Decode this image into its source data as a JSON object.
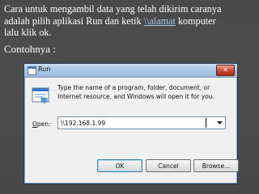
{
  "slide": {
    "line1": "Cara untuk mengambil data yang telah dikirim caranya",
    "line2_before": "adalah pilih aplikasi Run dan ketik ",
    "link": "\\\\alamat",
    "line2_after": " komputer",
    "line3": "lalu klik ok.",
    "example_label": "Contohnya :"
  },
  "dialog": {
    "title": "Run",
    "close_glyph": "✕",
    "description": "Type the name of a program, folder, document, or Internet resource, and Windows will open it for you.",
    "open_label_underlined": "O",
    "open_label_rest": "pen:",
    "open_value": "\\\\192.168.1.99",
    "ok_label": "OK",
    "cancel_label": "Cancel",
    "browse_label": "Browse..."
  },
  "icons": {
    "title": "run-app-icon",
    "run": "run-window-icon",
    "dropdown": "chevron-down-icon"
  },
  "colors": {
    "slide_bg": "#4a4a4a",
    "link": "#9ec7ec",
    "titlebar": "#a9c6e4",
    "close_button": "#c7432b"
  }
}
